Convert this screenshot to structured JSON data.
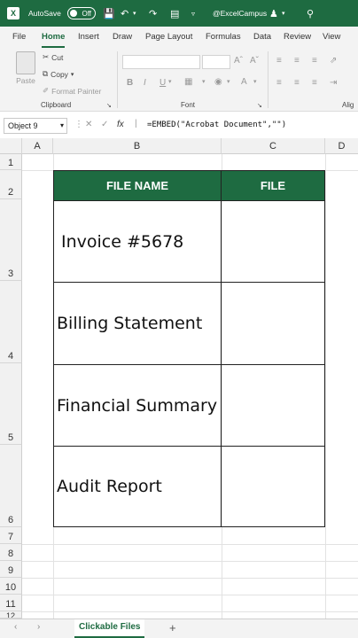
{
  "titlebar": {
    "logo": "X",
    "autosave_label": "AutoSave",
    "toggle_label": "Off",
    "account": "@ExcelCampus"
  },
  "tabs": [
    "File",
    "Home",
    "Insert",
    "Draw",
    "Page Layout",
    "Formulas",
    "Data",
    "Review",
    "View"
  ],
  "ribbon": {
    "clipboard": {
      "paste": "Paste",
      "cut": "Cut",
      "copy": "Copy",
      "format_painter": "Format Painter",
      "group": "Clipboard"
    },
    "font": {
      "bold": "B",
      "italic": "I",
      "underline": "U",
      "group": "Font"
    },
    "alignment": {
      "group": "Alig"
    }
  },
  "formula_bar": {
    "name_box": "Object 9",
    "fx": "fx",
    "formula": "=EMBED(\"Acrobat Document\",\"\")"
  },
  "columns": [
    "A",
    "B",
    "C",
    "D"
  ],
  "rows": [
    "1",
    "2",
    "3",
    "4",
    "5",
    "6",
    "7",
    "8",
    "9",
    "10",
    "11",
    "12"
  ],
  "table": {
    "headers": [
      "FILE NAME",
      "FILE"
    ],
    "rows": [
      {
        "name": "Invoice #5678"
      },
      {
        "name": "Billing Statement"
      },
      {
        "name": "Financial Summary"
      },
      {
        "name": "Audit Report"
      }
    ]
  },
  "sheet": {
    "active_tab": "Clickable Files",
    "add": "+",
    "prev": "‹",
    "next": "›"
  },
  "colors": {
    "brand": "#1e6b41",
    "header_fill": "#1e6b41"
  }
}
